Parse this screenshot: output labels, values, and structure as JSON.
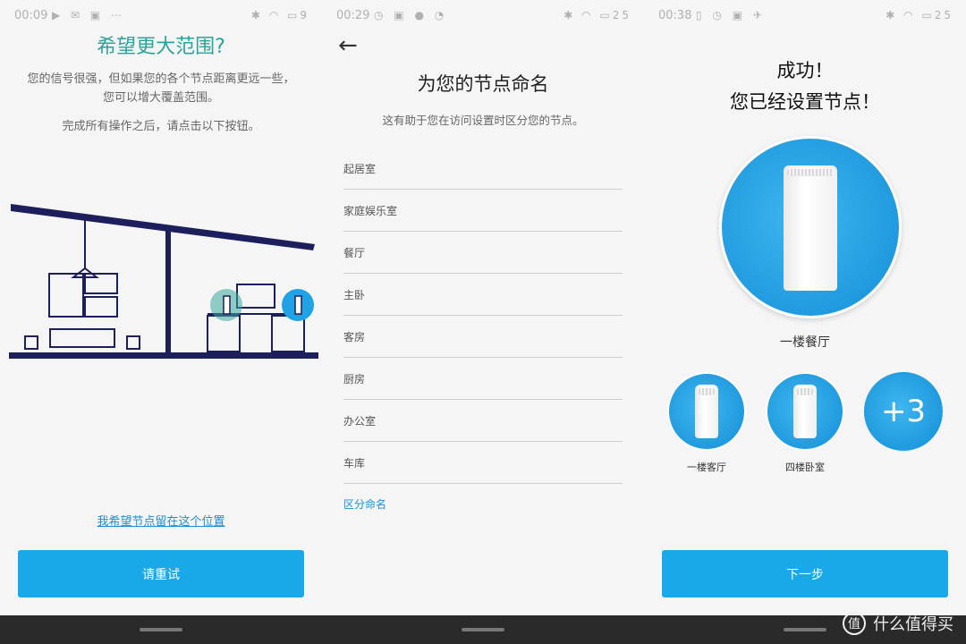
{
  "panel1": {
    "status": {
      "time": "00:09",
      "battery": "9"
    },
    "title": "希望更大范围?",
    "desc": "您的信号很强，但如果您的各个节点距离更远一些，您可以增大覆盖范围。",
    "desc2": "完成所有操作之后，请点击以下按钮。",
    "link": "我希望节点留在这个位置",
    "button": "请重试"
  },
  "panel2": {
    "status": {
      "time": "00:29",
      "battery": "25"
    },
    "title": "为您的节点命名",
    "subtitle": "这有助于您在访问设置时区分您的节点。",
    "rooms": [
      "起居室",
      "家庭娱乐室",
      "餐厅",
      "主卧",
      "客房",
      "厨房",
      "办公室",
      "车库"
    ],
    "custom": "区分命名"
  },
  "panel3": {
    "status": {
      "time": "00:38",
      "battery": "25"
    },
    "title1": "成功！",
    "title2": "您已经设置节点！",
    "main_node": "一楼餐厅",
    "node1": "一楼客厅",
    "node2": "四楼卧室",
    "more": "+3",
    "button": "下一步"
  },
  "watermark": "什么值得买",
  "colors": {
    "accent": "#19a8ea",
    "teal": "#2aa39a",
    "link": "#1a8fd8"
  }
}
